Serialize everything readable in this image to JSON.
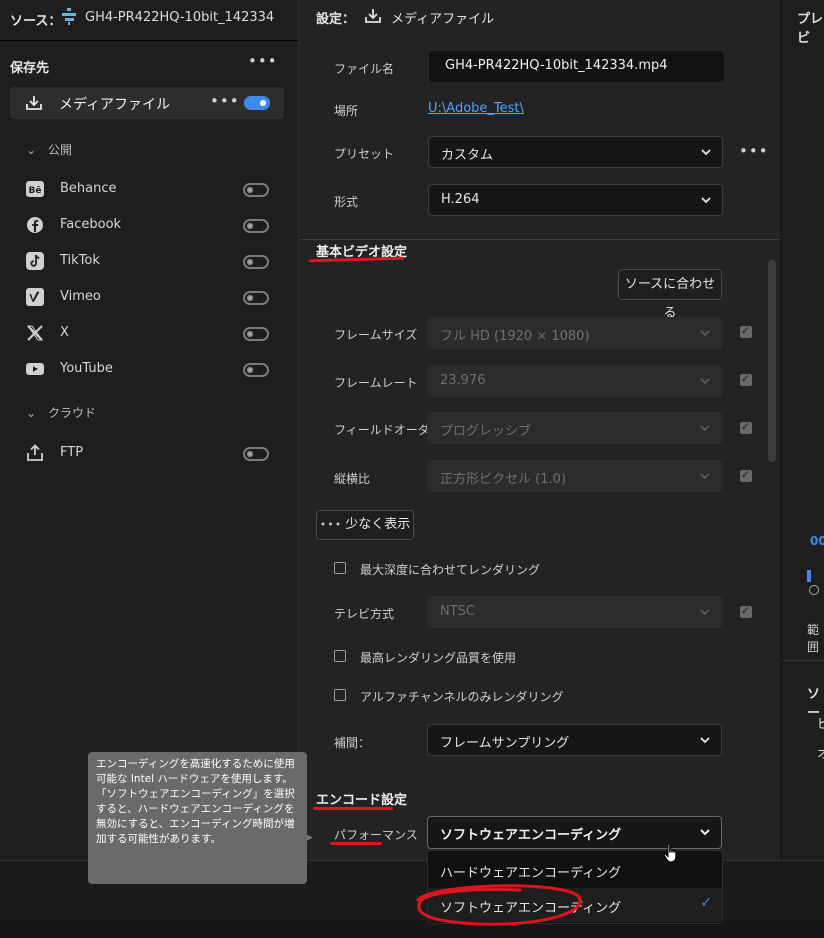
{
  "source": {
    "label": "ソース：",
    "filename": "GH4-PR422HQ-10bit_142334"
  },
  "destinations": {
    "title": "保存先",
    "more": "•••",
    "media_file": {
      "label": "メディアファイル",
      "more": "•••",
      "enabled": true
    },
    "groups": [
      {
        "name": "公開",
        "items": [
          {
            "label": "Behance",
            "icon": "behance-icon"
          },
          {
            "label": "Facebook",
            "icon": "facebook-icon"
          },
          {
            "label": "TikTok",
            "icon": "tiktok-icon"
          },
          {
            "label": "Vimeo",
            "icon": "vimeo-icon"
          },
          {
            "label": "X",
            "icon": "x-icon"
          },
          {
            "label": "YouTube",
            "icon": "youtube-icon"
          }
        ]
      },
      {
        "name": "クラウド",
        "items": [
          {
            "label": "FTP",
            "icon": "upload-icon"
          }
        ]
      }
    ]
  },
  "settings": {
    "title": "設定：",
    "subtitle": "メディアファイル",
    "filename_label": "ファイル名",
    "filename_value": "GH4-PR422HQ-10bit_142334.mp4",
    "location_label": "場所",
    "location_value": "U:\\Adobe_Test\\",
    "preset_label": "プリセット",
    "preset_value": "カスタム",
    "preset_more": "•••",
    "format_label": "形式",
    "format_value": "H.264"
  },
  "basic_video": {
    "header": "基本ビデオ設定",
    "match_source_button": "ソースに合わせる",
    "rows": [
      {
        "label": "フレームサイズ",
        "value": "フル HD (1920 × 1080)",
        "checked": true
      },
      {
        "label": "フレームレート",
        "value": "23.976",
        "checked": true
      },
      {
        "label": "フィールドオーダー",
        "value": "プログレッシブ",
        "checked": true
      },
      {
        "label": "縦横比",
        "value": "正方形ピクセル (1.0)",
        "checked": true
      }
    ],
    "show_less_button": "少なく表示",
    "max_depth_label": "最大深度に合わせてレンダリング",
    "tv_standard_label": "テレビ方式",
    "tv_standard_value": "NTSC",
    "max_quality_label": "最高レンダリング品質を使用",
    "alpha_only_label": "アルファチャンネルのみレンダリング",
    "interp_label": "補間：",
    "interp_value": "フレームサンプリング"
  },
  "encode": {
    "header": "エンコード設定",
    "performance_label": "パフォーマンス",
    "performance_value": "ソフトウェアエンコーディング",
    "options": [
      {
        "label": "ハードウェアエンコーディング",
        "selected": false
      },
      {
        "label": "ソフトウェアエンコーディング",
        "selected": true
      }
    ],
    "check_mark": "✓"
  },
  "tooltip": "エンコーディングを高速化するために使用可能な Intel ハードウェアを使用します。「ソフトウェアエンコーディング」を選択すると、ハードウェアエンコーディングを無効にすると、エンコーディング時間が増加する可能性があります。",
  "right_panel": {
    "title": "プレビ",
    "timecode": "00",
    "range": "範囲",
    "src": "ソー",
    "l1": "ビ",
    "l2": "オ"
  },
  "colors": {
    "accent": "#3d8ae8",
    "annotation_red": "#e0141e",
    "link": "#4da3ff"
  }
}
